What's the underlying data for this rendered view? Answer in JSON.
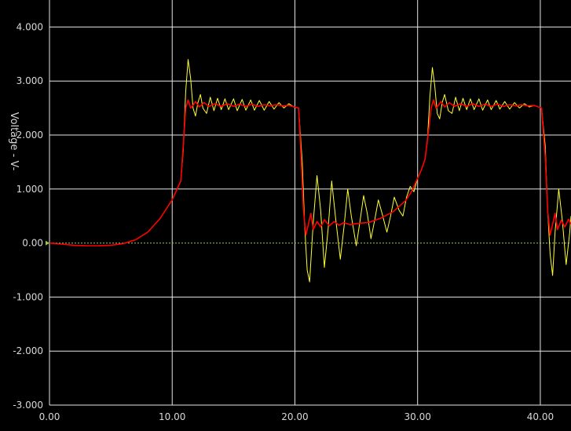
{
  "chart_data": {
    "type": "line",
    "ylabel": "Voltage - V-",
    "xlabel": "",
    "xlim": [
      0,
      42.5
    ],
    "ylim": [
      -3,
      4.5
    ],
    "grid": true,
    "x_ticks": [
      0,
      10,
      20,
      30,
      40
    ],
    "x_tick_labels": [
      "0.00",
      "10.00",
      "20.00",
      "30.00",
      "40.00"
    ],
    "y_ticks": [
      4,
      3,
      2,
      1,
      0,
      -1,
      -2,
      -3
    ],
    "y_tick_labels": [
      "4.000",
      "3.000",
      "2.000",
      "1.000",
      "0.00",
      "-1.000",
      "-2.000",
      "-3.000"
    ],
    "colors": {
      "background": "#000000",
      "grid": "#e6e6e6",
      "zero_line": "#8ed04a",
      "series_yellow": "#ffff33",
      "series_red": "#ff0000",
      "text": "#d8d8d8"
    },
    "series": [
      {
        "color": "#ffff33",
        "points": [
          [
            0,
            0
          ],
          [
            1,
            -0.02
          ],
          [
            2,
            -0.04
          ],
          [
            3,
            -0.05
          ],
          [
            4,
            -0.05
          ],
          [
            5,
            -0.04
          ],
          [
            6,
            -0.01
          ],
          [
            7,
            0.06
          ],
          [
            8,
            0.2
          ],
          [
            9,
            0.45
          ],
          [
            10,
            0.8
          ],
          [
            10.7,
            1.15
          ],
          [
            10.9,
            1.7
          ],
          [
            11.1,
            2.8
          ],
          [
            11.3,
            3.4
          ],
          [
            11.5,
            3.05
          ],
          [
            11.7,
            2.5
          ],
          [
            11.9,
            2.35
          ],
          [
            12.1,
            2.6
          ],
          [
            12.3,
            2.75
          ],
          [
            12.5,
            2.5
          ],
          [
            12.8,
            2.4
          ],
          [
            13.1,
            2.7
          ],
          [
            13.4,
            2.45
          ],
          [
            13.7,
            2.68
          ],
          [
            14,
            2.47
          ],
          [
            14.3,
            2.67
          ],
          [
            14.6,
            2.47
          ],
          [
            15,
            2.67
          ],
          [
            15.3,
            2.45
          ],
          [
            15.7,
            2.66
          ],
          [
            16,
            2.46
          ],
          [
            16.4,
            2.65
          ],
          [
            16.7,
            2.46
          ],
          [
            17.1,
            2.64
          ],
          [
            17.5,
            2.46
          ],
          [
            17.9,
            2.62
          ],
          [
            18.3,
            2.48
          ],
          [
            18.7,
            2.6
          ],
          [
            19.1,
            2.5
          ],
          [
            19.5,
            2.58
          ],
          [
            19.9,
            2.52
          ],
          [
            20.3,
            2.5
          ],
          [
            20.6,
            1.5
          ],
          [
            20.8,
            0.3
          ],
          [
            21,
            -0.5
          ],
          [
            21.2,
            -0.72
          ],
          [
            21.5,
            0.4
          ],
          [
            21.8,
            1.25
          ],
          [
            22.1,
            0.6
          ],
          [
            22.4,
            -0.45
          ],
          [
            22.7,
            0.25
          ],
          [
            23,
            1.15
          ],
          [
            23.3,
            0.5
          ],
          [
            23.7,
            -0.3
          ],
          [
            24,
            0.3
          ],
          [
            24.3,
            1.0
          ],
          [
            24.6,
            0.5
          ],
          [
            25,
            -0.05
          ],
          [
            25.3,
            0.4
          ],
          [
            25.6,
            0.88
          ],
          [
            25.9,
            0.55
          ],
          [
            26.2,
            0.08
          ],
          [
            26.5,
            0.42
          ],
          [
            26.8,
            0.8
          ],
          [
            27.1,
            0.55
          ],
          [
            27.5,
            0.2
          ],
          [
            27.8,
            0.5
          ],
          [
            28.1,
            0.85
          ],
          [
            28.5,
            0.6
          ],
          [
            28.8,
            0.5
          ],
          [
            29.1,
            0.85
          ],
          [
            29.4,
            1.05
          ],
          [
            29.7,
            0.95
          ],
          [
            30,
            1.2
          ],
          [
            30.3,
            1.35
          ],
          [
            30.6,
            1.55
          ],
          [
            30.8,
            1.9
          ],
          [
            31,
            2.7
          ],
          [
            31.2,
            3.25
          ],
          [
            31.4,
            2.9
          ],
          [
            31.6,
            2.4
          ],
          [
            31.8,
            2.3
          ],
          [
            32,
            2.6
          ],
          [
            32.2,
            2.75
          ],
          [
            32.5,
            2.45
          ],
          [
            32.8,
            2.4
          ],
          [
            33.1,
            2.7
          ],
          [
            33.4,
            2.45
          ],
          [
            33.7,
            2.68
          ],
          [
            34,
            2.47
          ],
          [
            34.3,
            2.67
          ],
          [
            34.6,
            2.47
          ],
          [
            35,
            2.67
          ],
          [
            35.3,
            2.46
          ],
          [
            35.7,
            2.65
          ],
          [
            36,
            2.47
          ],
          [
            36.4,
            2.64
          ],
          [
            36.7,
            2.48
          ],
          [
            37.1,
            2.62
          ],
          [
            37.5,
            2.48
          ],
          [
            37.9,
            2.6
          ],
          [
            38.3,
            2.5
          ],
          [
            38.7,
            2.58
          ],
          [
            39.1,
            2.52
          ],
          [
            39.5,
            2.55
          ],
          [
            40.1,
            2.5
          ],
          [
            40.4,
            1.8
          ],
          [
            40.6,
            0.6
          ],
          [
            40.8,
            -0.2
          ],
          [
            41,
            -0.6
          ],
          [
            41.2,
            0.2
          ],
          [
            41.5,
            1.0
          ],
          [
            41.8,
            0.4
          ],
          [
            42.1,
            -0.4
          ],
          [
            42.4,
            0.2
          ],
          [
            42.5,
            0.5
          ]
        ]
      },
      {
        "color": "#ff0000",
        "points": [
          [
            0,
            0
          ],
          [
            1,
            -0.02
          ],
          [
            2,
            -0.04
          ],
          [
            3,
            -0.05
          ],
          [
            4,
            -0.05
          ],
          [
            5,
            -0.04
          ],
          [
            6,
            -0.01
          ],
          [
            7,
            0.06
          ],
          [
            8,
            0.2
          ],
          [
            9,
            0.45
          ],
          [
            10,
            0.8
          ],
          [
            10.7,
            1.15
          ],
          [
            10.9,
            1.8
          ],
          [
            11.1,
            2.5
          ],
          [
            11.3,
            2.65
          ],
          [
            11.5,
            2.5
          ],
          [
            11.7,
            2.55
          ],
          [
            11.9,
            2.62
          ],
          [
            12.2,
            2.52
          ],
          [
            12.6,
            2.6
          ],
          [
            13,
            2.53
          ],
          [
            13.5,
            2.58
          ],
          [
            14,
            2.53
          ],
          [
            14.5,
            2.58
          ],
          [
            15,
            2.53
          ],
          [
            15.5,
            2.57
          ],
          [
            16,
            2.53
          ],
          [
            16.5,
            2.57
          ],
          [
            17,
            2.53
          ],
          [
            17.5,
            2.56
          ],
          [
            18,
            2.54
          ],
          [
            18.5,
            2.56
          ],
          [
            19,
            2.54
          ],
          [
            19.5,
            2.55
          ],
          [
            20.3,
            2.5
          ],
          [
            20.5,
            1.6
          ],
          [
            20.7,
            0.6
          ],
          [
            20.9,
            0.15
          ],
          [
            21.1,
            0.35
          ],
          [
            21.3,
            0.55
          ],
          [
            21.5,
            0.25
          ],
          [
            21.8,
            0.4
          ],
          [
            22.1,
            0.3
          ],
          [
            22.4,
            0.43
          ],
          [
            22.8,
            0.32
          ],
          [
            23.2,
            0.4
          ],
          [
            23.6,
            0.33
          ],
          [
            24,
            0.38
          ],
          [
            24.5,
            0.34
          ],
          [
            25,
            0.36
          ],
          [
            25.5,
            0.37
          ],
          [
            26,
            0.38
          ],
          [
            26.5,
            0.42
          ],
          [
            27,
            0.46
          ],
          [
            27.5,
            0.52
          ],
          [
            28,
            0.58
          ],
          [
            28.5,
            0.68
          ],
          [
            29,
            0.78
          ],
          [
            29.5,
            0.95
          ],
          [
            30,
            1.2
          ],
          [
            30.3,
            1.35
          ],
          [
            30.6,
            1.55
          ],
          [
            30.9,
            2.1
          ],
          [
            31.1,
            2.5
          ],
          [
            31.3,
            2.65
          ],
          [
            31.5,
            2.5
          ],
          [
            31.7,
            2.55
          ],
          [
            31.9,
            2.62
          ],
          [
            32.2,
            2.52
          ],
          [
            32.6,
            2.6
          ],
          [
            33,
            2.53
          ],
          [
            33.5,
            2.58
          ],
          [
            34,
            2.53
          ],
          [
            34.5,
            2.58
          ],
          [
            35,
            2.53
          ],
          [
            35.5,
            2.57
          ],
          [
            36,
            2.53
          ],
          [
            36.5,
            2.57
          ],
          [
            37,
            2.53
          ],
          [
            37.5,
            2.56
          ],
          [
            38,
            2.54
          ],
          [
            38.5,
            2.56
          ],
          [
            39,
            2.54
          ],
          [
            39.5,
            2.55
          ],
          [
            40.1,
            2.5
          ],
          [
            40.4,
            1.6
          ],
          [
            40.6,
            0.6
          ],
          [
            40.8,
            0.15
          ],
          [
            41,
            0.35
          ],
          [
            41.2,
            0.55
          ],
          [
            41.4,
            0.25
          ],
          [
            41.7,
            0.42
          ],
          [
            42,
            0.3
          ],
          [
            42.3,
            0.44
          ],
          [
            42.5,
            0.35
          ]
        ]
      }
    ]
  }
}
